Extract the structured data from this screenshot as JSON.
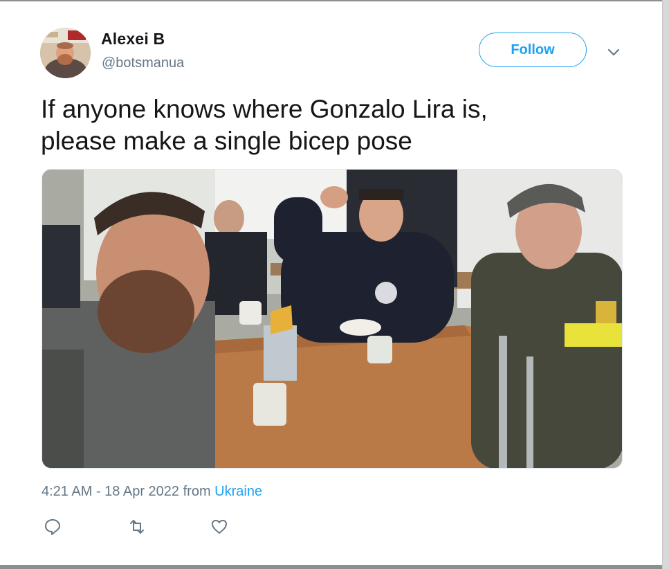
{
  "author": {
    "name": "Alexei B",
    "handle": "@botsmanua",
    "avatar_icon": "profile-photo"
  },
  "follow_label": "Follow",
  "tweet": {
    "line1": "If anyone knows where Gonzalo Lira is,",
    "line2": "please make a single bicep pose"
  },
  "photo": {
    "description_icon": "photo-of-men-at-cafeteria-table"
  },
  "meta": {
    "time": "4:21 AM",
    "separator": " - ",
    "date": "18 Apr 2022",
    "from_word": " from ",
    "source": "Ukraine"
  },
  "actions": {
    "reply_icon": "reply-icon",
    "retweet_icon": "retweet-icon",
    "like_icon": "heart-icon"
  },
  "colors": {
    "accent": "#1da1f2",
    "text": "#14171a",
    "secondary": "#657786"
  }
}
